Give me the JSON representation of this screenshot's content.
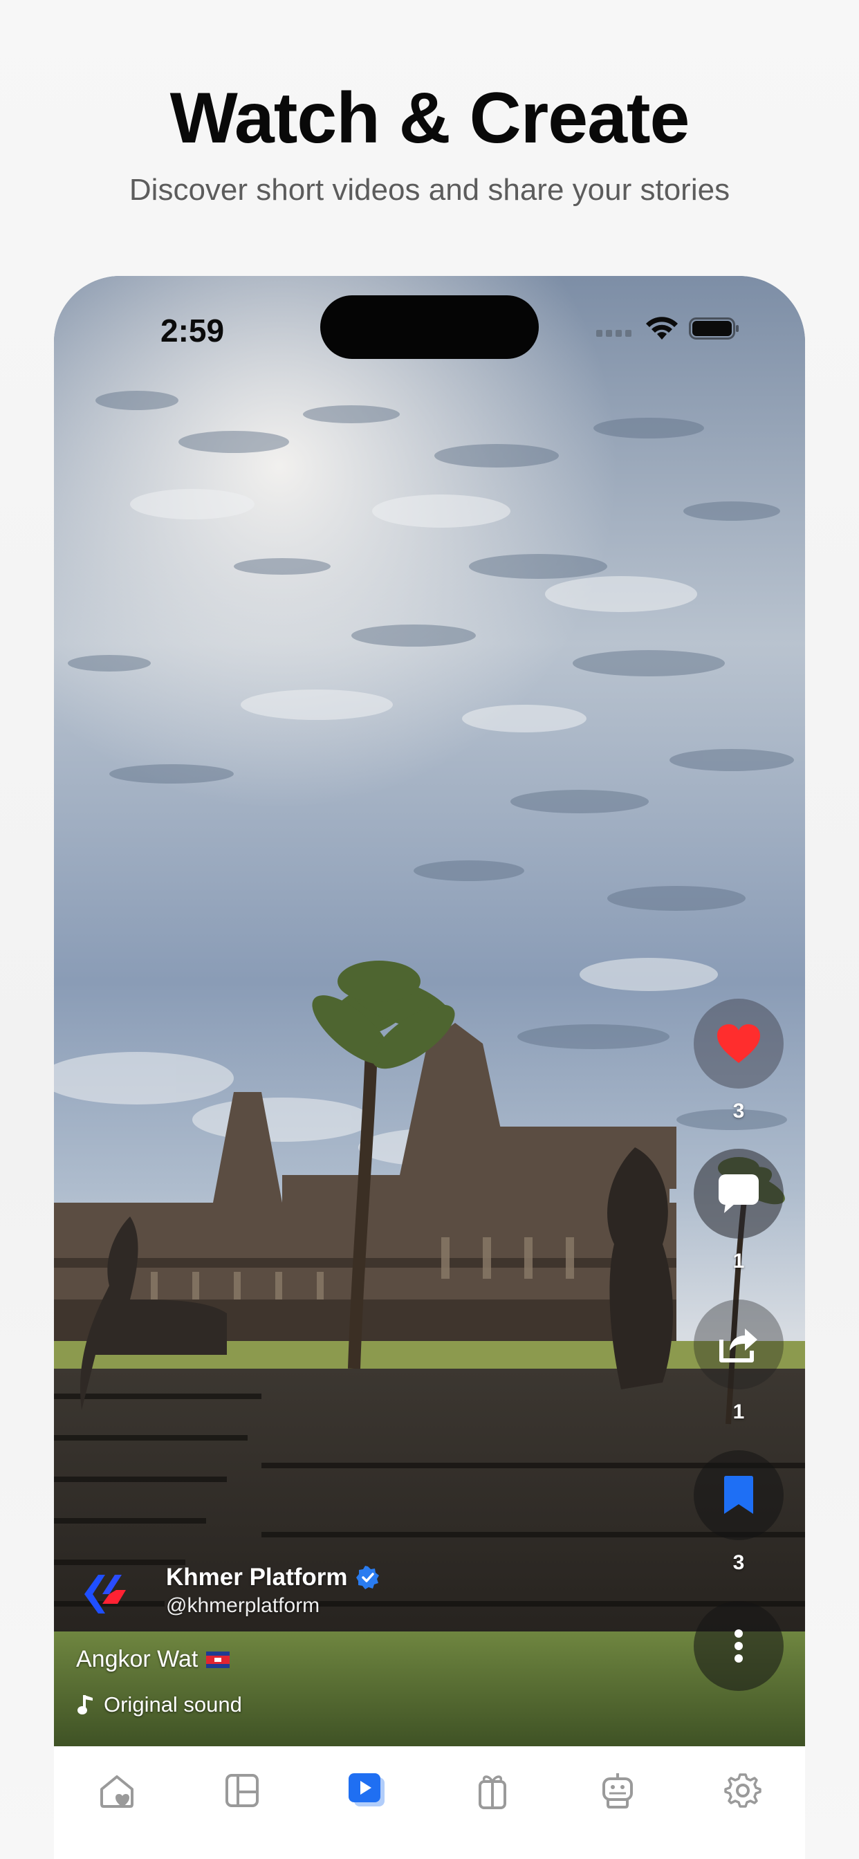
{
  "header": {
    "title": "Watch & Create",
    "subtitle": "Discover short videos and share your stories"
  },
  "status_bar": {
    "time": "2:59",
    "icons": [
      "signal-icon",
      "wifi-icon",
      "battery-icon"
    ]
  },
  "actions": {
    "like": {
      "icon": "heart-icon",
      "count": "3",
      "color": "#ff2d2d"
    },
    "comment": {
      "icon": "comment-icon",
      "count": "1"
    },
    "share": {
      "icon": "share-icon",
      "count": "1"
    },
    "save": {
      "icon": "bookmark-icon",
      "count": "3",
      "color": "#1e6ff5"
    },
    "more": {
      "icon": "more-vertical-icon"
    }
  },
  "creator": {
    "name": "Khmer Platform",
    "handle": "@khmerplatform",
    "verified": true,
    "verified_color": "#2a7cf0"
  },
  "video": {
    "caption": "Angkor Wat",
    "sound": "Original sound"
  },
  "tabbar": {
    "items": [
      {
        "name": "home-heart-icon",
        "active": false
      },
      {
        "name": "layout-icon",
        "active": false
      },
      {
        "name": "video-play-icon",
        "active": true
      },
      {
        "name": "gift-icon",
        "active": false
      },
      {
        "name": "robot-icon",
        "active": false
      },
      {
        "name": "settings-icon",
        "active": false
      }
    ],
    "active_color": "#1f6ff2",
    "inactive_color": "#9a9a9a"
  }
}
